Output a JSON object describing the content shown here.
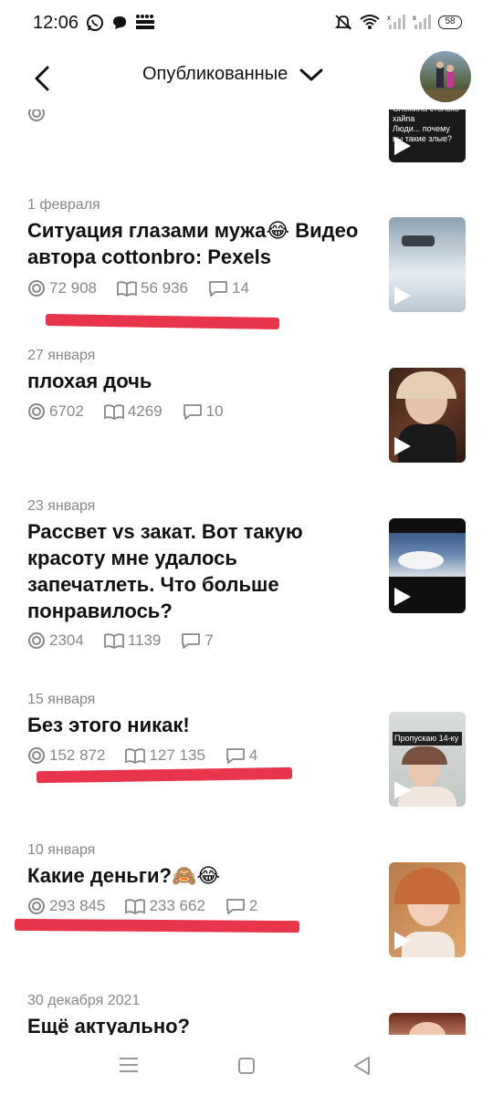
{
  "status_bar": {
    "time": "12:06",
    "battery": "58",
    "icons_left": [
      "whatsapp-icon",
      "chat-bubble-icon",
      "detmir-icon"
    ],
    "icons_right": [
      "mute-bell-icon",
      "wifi-icon",
      "signal-icon",
      "signal-icon",
      "battery-icon"
    ]
  },
  "header": {
    "title": "Опубликованные",
    "back_icon": "chevron-left-icon",
    "dropdown_icon": "chevron-down-icon"
  },
  "partial_top_item": {
    "thumb_caption": "Сложила столько хайпа\nЛюди... почему вы такие злые?"
  },
  "items": [
    {
      "date": "1 февраля",
      "title": "Ситуация глазами мужа😂 Видео автора cottonbro: Pexels",
      "views": "72 908",
      "reads": "56 936",
      "comments": "14"
    },
    {
      "date": "27 января",
      "title": "плохая дочь",
      "views": "6702",
      "reads": "4269",
      "comments": "10"
    },
    {
      "date": "23 января",
      "title": "Рассвет vs закат. Вот такую красоту мне удалось запечатлеть. Что больше понравилось?",
      "views": "2304",
      "reads": "1139",
      "comments": "7"
    },
    {
      "date": "15 января",
      "title": "Без этого никак!",
      "views": "152 872",
      "reads": "127 135",
      "comments": "4",
      "thumb_caption": "Пропускаю 14-ку"
    },
    {
      "date": "10 января",
      "title": "Какие деньги?🙈😂",
      "views": "293 845",
      "reads": "233 662",
      "comments": "2"
    },
    {
      "date": "30 декабря 2021",
      "title": "Ещё актуально?"
    }
  ],
  "colors": {
    "accent_red": "#e8354b",
    "meta_gray": "#888888"
  }
}
